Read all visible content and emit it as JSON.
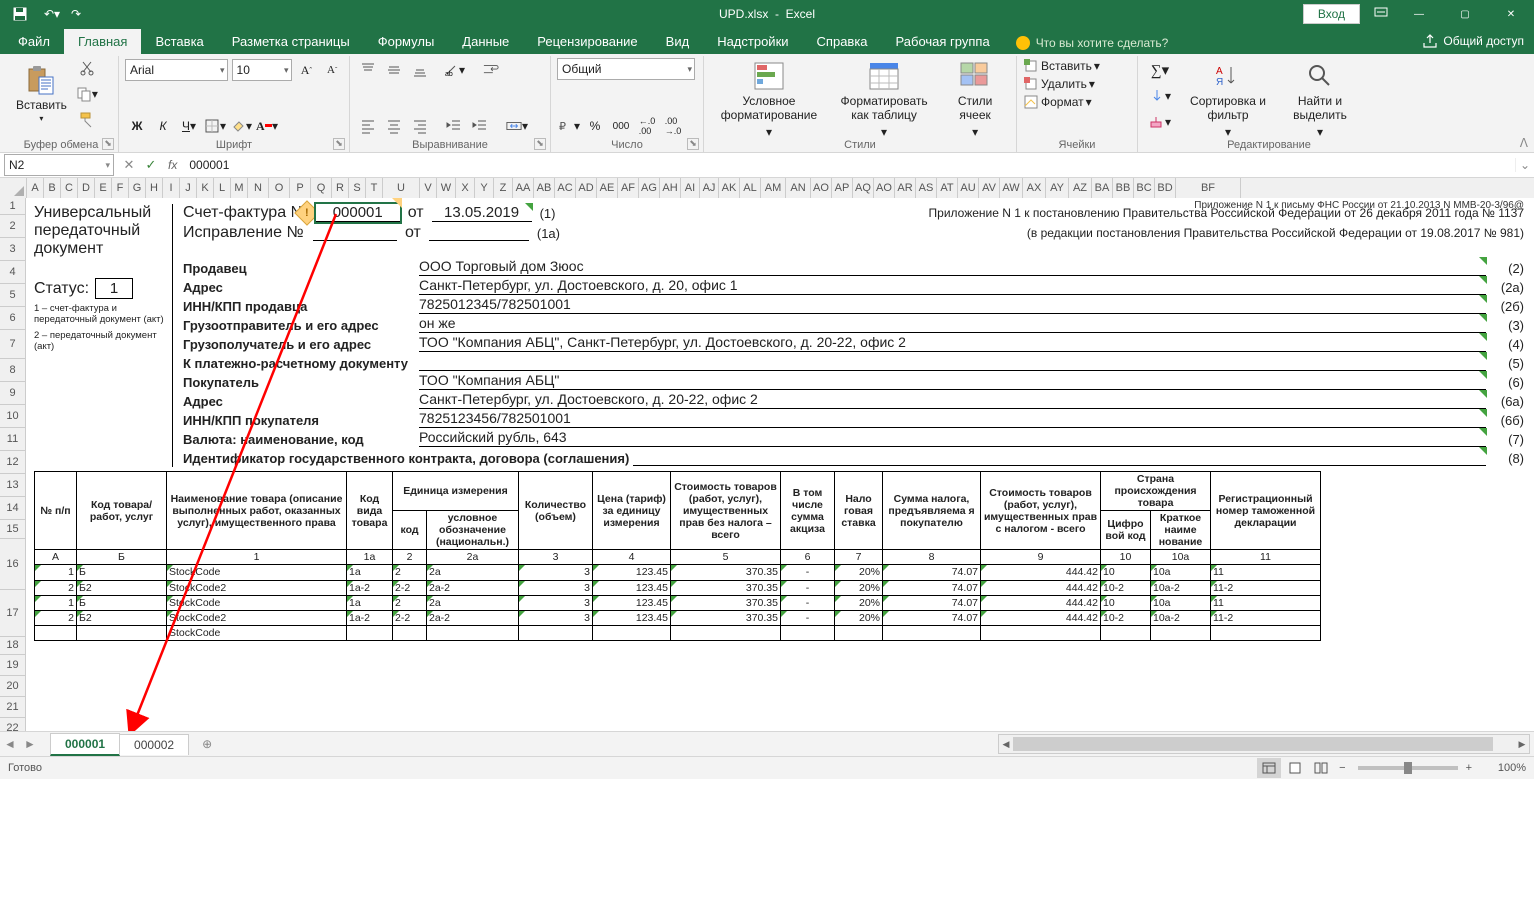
{
  "window": {
    "file": "UPD.xlsx",
    "app": "Excel",
    "login": "Вход"
  },
  "tabs": {
    "file": "Файл",
    "home": "Главная",
    "insert": "Вставка",
    "layout": "Разметка страницы",
    "formulas": "Формулы",
    "data": "Данные",
    "review": "Рецензирование",
    "view": "Вид",
    "addins": "Надстройки",
    "help": "Справка",
    "team": "Рабочая группа",
    "tellme": "Что вы хотите сделать?",
    "share": "Общий доступ"
  },
  "ribbon": {
    "clipboard": {
      "paste": "Вставить",
      "label": "Буфер обмена"
    },
    "font": {
      "name": "Arial",
      "size": "10",
      "label": "Шрифт"
    },
    "align": {
      "label": "Выравнивание"
    },
    "number": {
      "format": "Общий",
      "label": "Число"
    },
    "styles": {
      "cond": "Условное форматирование",
      "table": "Форматировать как таблицу",
      "cell": "Стили ячеек",
      "label": "Стили"
    },
    "cells": {
      "ins": "Вставить",
      "del": "Удалить",
      "fmt": "Формат",
      "label": "Ячейки"
    },
    "editing": {
      "sort": "Сортировка и фильтр",
      "find": "Найти и выделить",
      "label": "Редактирование"
    }
  },
  "formula": {
    "cell": "N2",
    "value": "000001"
  },
  "cols": [
    "A",
    "B",
    "C",
    "D",
    "E",
    "F",
    "G",
    "H",
    "I",
    "J",
    "K",
    "L",
    "M",
    "N",
    "O",
    "P",
    "Q",
    "R",
    "S",
    "T",
    "U",
    "V",
    "W",
    "X",
    "Y",
    "Z",
    "AA",
    "AB",
    "AC",
    "AD",
    "AE",
    "AF",
    "AG",
    "AH",
    "AI",
    "AJ",
    "AK",
    "AL",
    "AM",
    "AN",
    "AO",
    "AP",
    "AQ",
    "AO",
    "AR",
    "AS",
    "AT",
    "AU",
    "AV",
    "AW",
    "AX",
    "AY",
    "AZ",
    "BA",
    "BB",
    "BC",
    "BD",
    "BF"
  ],
  "rows": [
    "1",
    "2",
    "3",
    "4",
    "5",
    "6",
    "7",
    "8",
    "9",
    "10",
    "11",
    "12",
    "13",
    "14",
    "15",
    "16",
    "17",
    "18",
    "19",
    "20",
    "21",
    "22"
  ],
  "doc": {
    "upd1": "Универсальный",
    "upd2": "передаточный",
    "upd3": "документ",
    "invoice_lbl": "Счет-фактура №",
    "invoice_no": "000001",
    "ot": "от",
    "invoice_date": "13.05.2019",
    "one": "(1)",
    "correction_lbl": "Исправление №",
    "onea": "(1а)",
    "status_lbl": "Статус:",
    "status_val": "1",
    "note1": "1 – счет-фактура и передаточный документ (акт)",
    "note2": "2 – передаточный документ (акт)",
    "seller": "Продавец",
    "seller_v": "ООО Торговый дом Зюос",
    "c2": "(2)",
    "addr": "Адрес",
    "addr_v": "Санкт-Петербург, ул. Достоевского, д. 20, офис 1",
    "c2a": "(2а)",
    "inn": "ИНН/КПП продавца",
    "inn_v": "7825012345/782501001",
    "c2b": "(2б)",
    "shipper": "Грузоотправитель и его адрес",
    "shipper_v": "он же",
    "c3": "(3)",
    "consignee": "Грузополучатель и его адрес",
    "consignee_v": "ТОО \"Компания АБЦ\", Санкт-Петербург, ул. Достоевского, д. 20-22, офис 2",
    "c4": "(4)",
    "payment": "К платежно-расчетному документу",
    "c5": "(5)",
    "buyer": "Покупатель",
    "buyer_v": "ТОО \"Компания АБЦ\"",
    "c6": "(6)",
    "baddr": "Адрес",
    "baddr_v": "Санкт-Петербург, ул. Достоевского, д. 20-22, офис 2",
    "c6a": "(6а)",
    "binn": "ИНН/КПП покупателя",
    "binn_v": "7825123456/782501001",
    "c6b": "(6б)",
    "currency": "Валюта: наименование, код",
    "currency_v": "Российский рубль, 643",
    "c7": "(7)",
    "contract": "Идентификатор государственного контракта, договора (соглашения)",
    "c8": "(8)",
    "annR": "Приложение N 1 к письму ФНС России от 21.10.2013 N ММВ-20-3/96@",
    "annR2": "Приложение N 1 к постановлению Правительства Российской Федерации от 26 декабря 2011 года № 1137",
    "annR3": "(в редакции постановления Правительства Российской Федерации от 19.08.2017 № 981)"
  },
  "th": {
    "no": "№ п/п",
    "code": "Код товара/работ, услуг",
    "name": "Наименование товара (описание выполненных работ, оказанных услуг), имущественного права",
    "kind": "Код вида товара",
    "unit": "Единица измерения",
    "ucode": "код",
    "uname": "условное обозначение (национальн.)",
    "qty": "Количество (объем)",
    "price": "Цена (тариф) за единицу измерения",
    "cost": "Стоимость товаров (работ, услуг), имущественных прав без налога – всего",
    "excise": "В том числе сумма акциза",
    "rate": "Нало говая ставка",
    "tax": "Сумма налога, предъявляема я покупателю",
    "total": "Стоимость товаров (работ, услуг), имущественных прав с налогом - всего",
    "country": "Страна происхождения товара",
    "ccode": "Цифро вой код",
    "cname": "Краткое наиме нование",
    "decl": "Регистрационный номер таможенной декларации",
    "hA": "А",
    "hB": "Б",
    "h1": "1",
    "h1a": "1а",
    "h2": "2",
    "h2a": "2а",
    "h3": "3",
    "h4": "4",
    "h5": "5",
    "h6": "6",
    "h7": "7",
    "h8": "8",
    "h9": "9",
    "h10": "10",
    "h10a": "10а",
    "h11": "11"
  },
  "rowsdata": [
    {
      "n": "1",
      "c": "Б",
      "name": "StockCode",
      "kind": "1a",
      "uc": "2",
      "un": "2a",
      "qty": "3",
      "price": "123.45",
      "cost": "370.35",
      "ex": "-",
      "rate": "20%",
      "tax": "74.07",
      "tot": "444.42",
      "cc": "10",
      "cn": "10a",
      "decl": "11"
    },
    {
      "n": "2",
      "c": "Б2",
      "name": "StockCode2",
      "kind": "1a-2",
      "uc": "2-2",
      "un": "2a-2",
      "qty": "3",
      "price": "123.45",
      "cost": "370.35",
      "ex": "-",
      "rate": "20%",
      "tax": "74.07",
      "tot": "444.42",
      "cc": "10-2",
      "cn": "10a-2",
      "decl": "11-2"
    },
    {
      "n": "1",
      "c": "Б",
      "name": "StockCode",
      "kind": "1a",
      "uc": "2",
      "un": "2a",
      "qty": "3",
      "price": "123.45",
      "cost": "370.35",
      "ex": "-",
      "rate": "20%",
      "tax": "74.07",
      "tot": "444.42",
      "cc": "10",
      "cn": "10a",
      "decl": "11"
    },
    {
      "n": "2",
      "c": "Б2",
      "name": "StockCode2",
      "kind": "1a-2",
      "uc": "2-2",
      "un": "2a-2",
      "qty": "3",
      "price": "123.45",
      "cost": "370.35",
      "ex": "-",
      "rate": "20%",
      "tax": "74.07",
      "tot": "444.42",
      "cc": "10-2",
      "cn": "10a-2",
      "decl": "11-2"
    }
  ],
  "sheets": {
    "s1": "000001",
    "s2": "000002"
  },
  "status": {
    "ready": "Готово",
    "zoom": "100%"
  }
}
